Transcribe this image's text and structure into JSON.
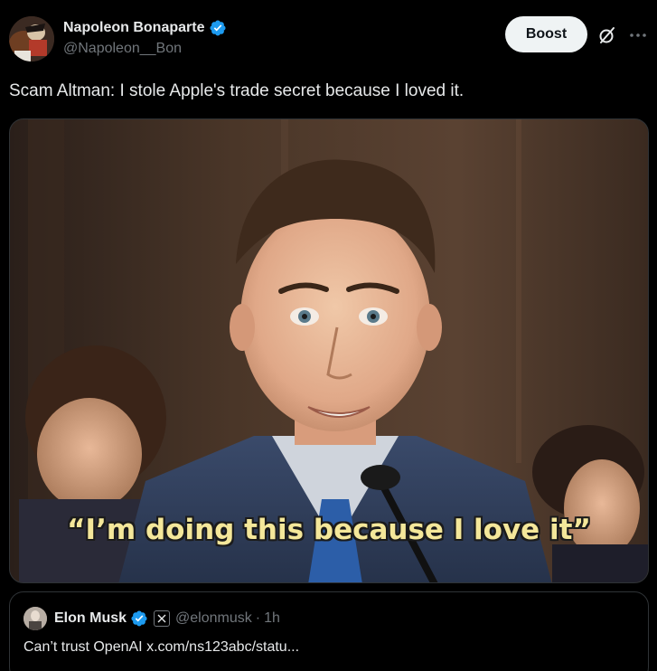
{
  "post": {
    "author": {
      "display_name": "Napoleon Bonaparte",
      "handle": "@Napoleon__Bon",
      "verified": true
    },
    "actions": {
      "boost_label": "Boost",
      "grok_icon": "grok-icon",
      "more_icon": "more-icon"
    },
    "text": "Scam Altman: I stole Apple's trade secret because I loved it.",
    "media": {
      "caption": "“I’m doing this because I love it”"
    }
  },
  "quoted_post": {
    "display_name": "Elon Musk",
    "verified": true,
    "affiliate_badge": "x-logo-icon",
    "handle": "@elonmusk",
    "separator": "·",
    "time": "1h",
    "text": "Can’t trust OpenAI x.com/ns123abc/statu..."
  },
  "colors": {
    "background": "#000000",
    "primary_text": "#e7e9ea",
    "secondary_text": "#71767b",
    "verified_blue": "#1d9bf0",
    "border": "#2f3336",
    "button_bg": "#eff3f4",
    "caption_yellow": "#f4e79a"
  }
}
